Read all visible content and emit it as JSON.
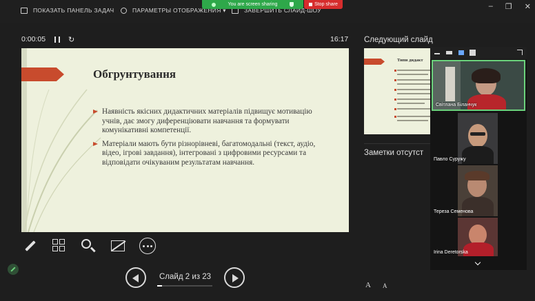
{
  "toolbar": {
    "taskbar_label": "ПОКАЗАТЬ ПАНЕЛЬ ЗАДАЧ",
    "display_settings_label": "ПАРАМЕТРЫ ОТОБРАЖЕНИЯ ▾",
    "end_show_label": "ЗАВЕРШИТЬ СЛАЙД-ШОУ"
  },
  "sharing": {
    "status_text": "You are screen sharing",
    "stop_label": "Stop share"
  },
  "window_controls": [
    "–",
    "❐",
    "✕"
  ],
  "presenter": {
    "elapsed_time": "0:00:05",
    "reset_glyph": "↻",
    "clock": "16:17"
  },
  "slide": {
    "title": "Обгрунтування",
    "bullets": [
      "Наявність якісних дидактичних матеріалів підвищує мотивацію учнів, дає змогу диференціювати навчання та формувати комунікативні компетенції.",
      "Матеріали мають бути різнорівневі, багатомодальні (текст, аудіо, відео, ігрові завдання), інтегровані з цифровими ресурсами та відповідати очікуваним результатам навчання."
    ]
  },
  "navigation": {
    "counter_text": "Слайд 2 из 23",
    "current_slide": 2,
    "total_slides": 23
  },
  "side_panel": {
    "next_slide_label": "Следующий слайд",
    "next_slide_title": "Типи дидакт",
    "notes_label": "Заметки отсутст",
    "font_increase": "A",
    "font_decrease": "A"
  },
  "participants": [
    {
      "name": "Світлана Біланчук",
      "active": true
    },
    {
      "name": "Павло Суружу"
    },
    {
      "name": "Тереза Семенова"
    },
    {
      "name": "Irina Deretorska"
    }
  ],
  "colors": {
    "accent_red": "#c84b2d",
    "share_green": "#2ea84a",
    "stop_red": "#d62d2d",
    "active_speaker_border": "#6bd27c"
  }
}
